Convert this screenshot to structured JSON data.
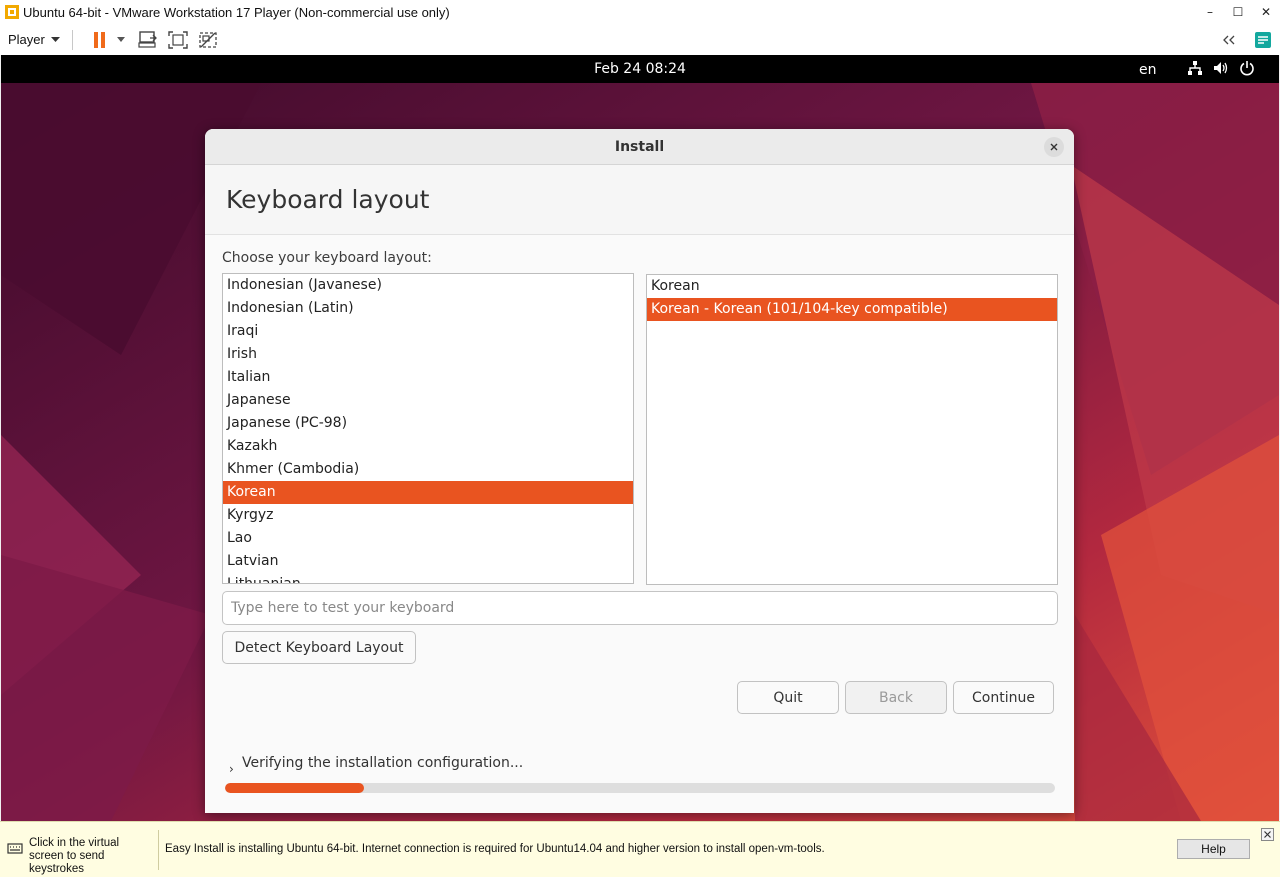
{
  "window": {
    "title": "Ubuntu 64-bit - VMware Workstation 17 Player (Non-commercial use only)",
    "minimize_glyph": "–",
    "maximize_glyph": "☐",
    "close_glyph": "✕"
  },
  "toolbar": {
    "player_menu": "Player",
    "icons": [
      "pause-icon",
      "send-ctrl-alt-del-icon",
      "fullscreen-icon",
      "unity-icon",
      "collapse-toolbar-icon",
      "notes-icon"
    ]
  },
  "ubuntu_topbar": {
    "clock": "Feb 24  08:24",
    "language": "en"
  },
  "dialog": {
    "title": "Install",
    "page_title": "Keyboard layout",
    "choose_label": "Choose your keyboard layout:",
    "layouts": [
      {
        "label": "Indonesian (Javanese)",
        "selected": false
      },
      {
        "label": "Indonesian (Latin)",
        "selected": false
      },
      {
        "label": "Iraqi",
        "selected": false
      },
      {
        "label": "Irish",
        "selected": false
      },
      {
        "label": "Italian",
        "selected": false
      },
      {
        "label": "Japanese",
        "selected": false
      },
      {
        "label": "Japanese (PC-98)",
        "selected": false
      },
      {
        "label": "Kazakh",
        "selected": false
      },
      {
        "label": "Khmer (Cambodia)",
        "selected": false
      },
      {
        "label": "Korean",
        "selected": true
      },
      {
        "label": "Kyrgyz",
        "selected": false
      },
      {
        "label": "Lao",
        "selected": false
      },
      {
        "label": "Latvian",
        "selected": false
      },
      {
        "label": "Lithuanian",
        "selected": false
      }
    ],
    "variants": [
      {
        "label": "Korean",
        "selected": false
      },
      {
        "label": "Korean - Korean (101/104-key compatible)",
        "selected": true
      }
    ],
    "test_placeholder": "Type here to test your keyboard",
    "detect_button": "Detect Keyboard Layout",
    "quit_button": "Quit",
    "back_button": "Back",
    "continue_button": "Continue",
    "progress_label": "Verifying the installation configuration...",
    "progress_chevron": "›",
    "progress_fraction": 0.168
  },
  "info_bar": {
    "hint": "Click in the virtual screen to send keystrokes",
    "message": "Easy Install is installing Ubuntu 64-bit. Internet connection is required for Ubuntu14.04 and higher version to install open-vm-tools.",
    "help_button": "Help"
  },
  "colors": {
    "ubuntu_orange": "#e95420",
    "topbar": "#000000",
    "info_bar_bg": "#fffde1"
  }
}
